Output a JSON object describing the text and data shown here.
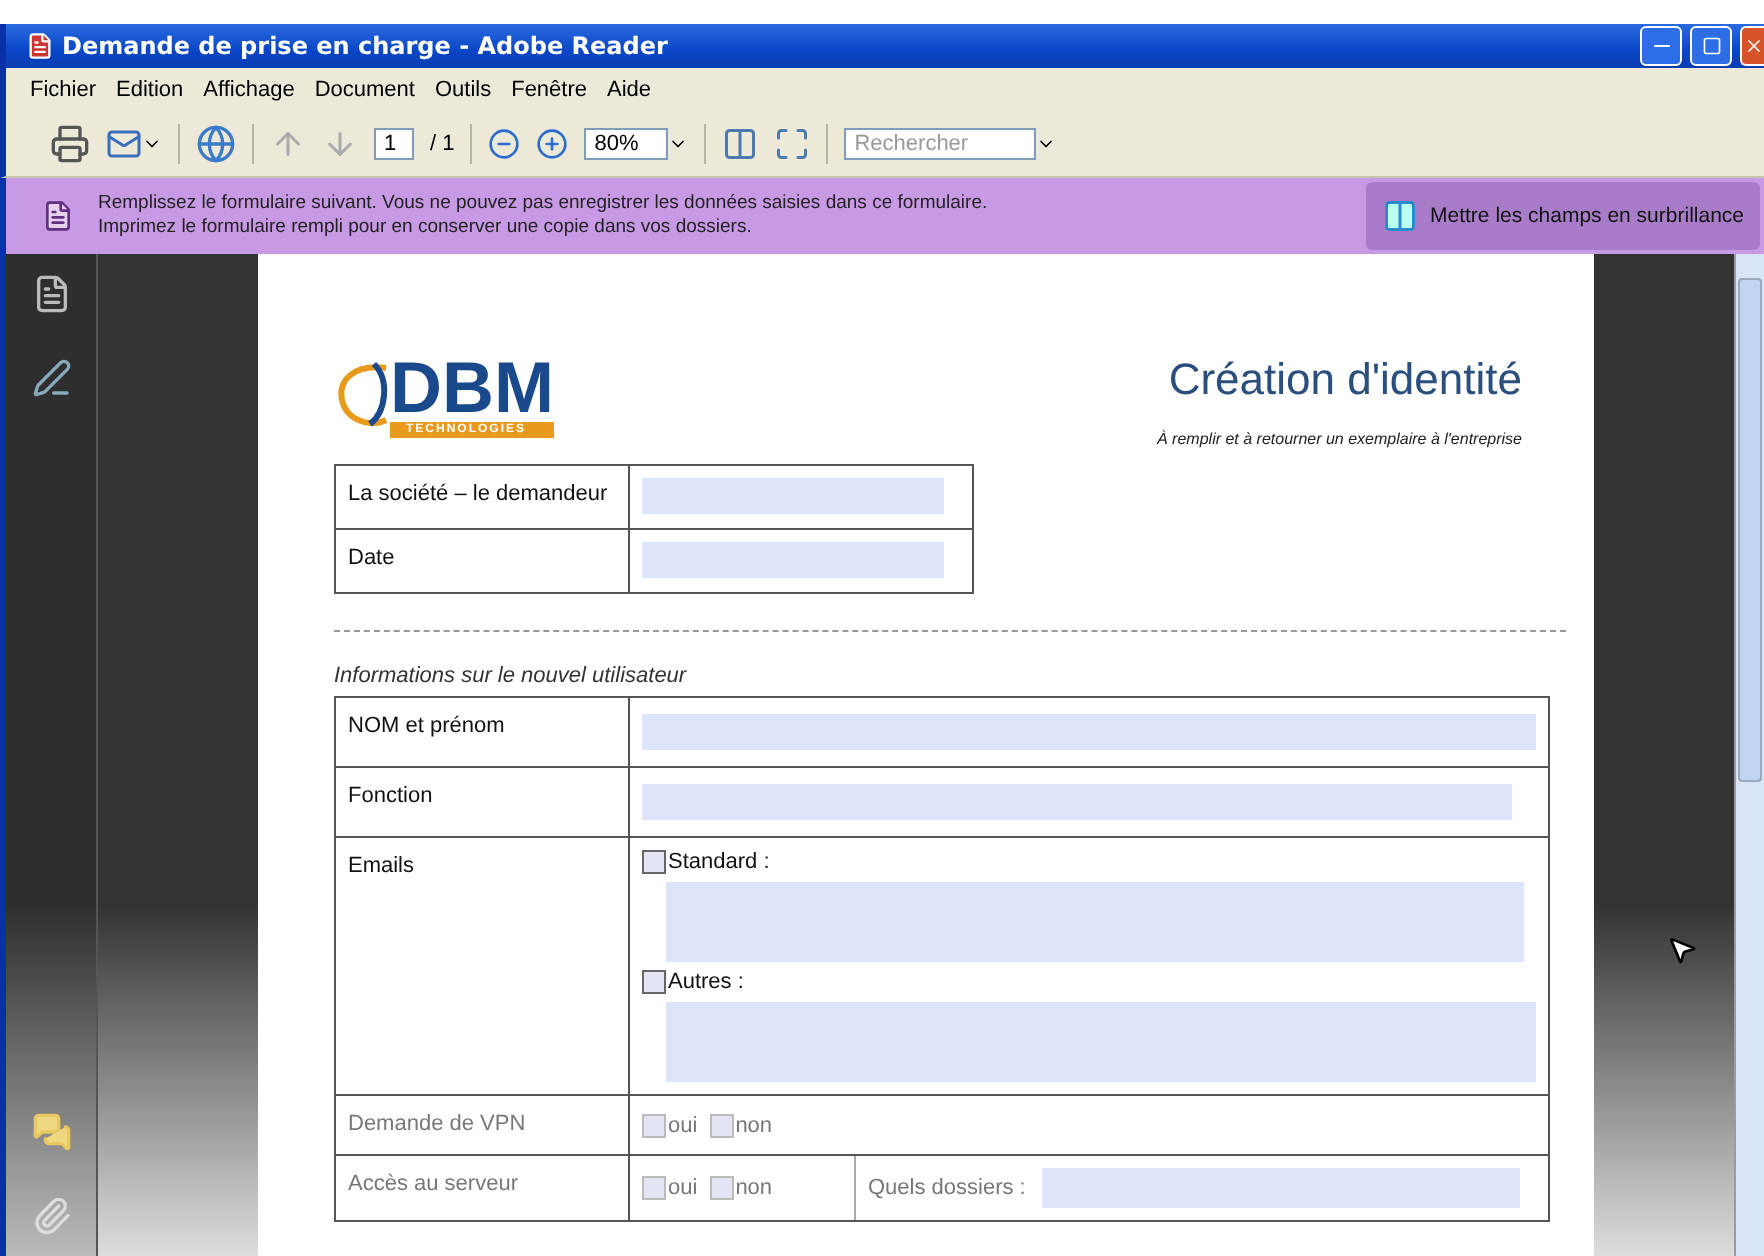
{
  "window": {
    "title": "Demande de prise en charge - Adobe Reader"
  },
  "menu": [
    "Fichier",
    "Edition",
    "Affichage",
    "Document",
    "Outils",
    "Fenêtre",
    "Aide"
  ],
  "toolbar": {
    "page": "1",
    "page_total": "/ 1",
    "zoom": "80%",
    "search": {
      "placeholder": "Rechercher"
    }
  },
  "notice": {
    "lines": [
      "Remplissez le formulaire suivant. Vous ne pouvez pas enregistrer les données saisies dans ce formulaire.",
      "Imprimez le formulaire rempli pour en conserver une copie dans vos dossiers."
    ],
    "button": "Mettre les champs en surbrillance"
  },
  "document": {
    "logo": {
      "name": "DBM",
      "tagline": "TECHNOLOGIES"
    },
    "title": "Création d'identité",
    "subtitle": "À remplir et à retourner un exemplaire à l'entreprise",
    "requester_rows": [
      {
        "label": "La société – le demandeur"
      },
      {
        "label": "Date"
      }
    ],
    "section": "Informations sur le nouvel utilisateur",
    "user_rows": [
      {
        "kind": "text",
        "label": "NOM et prénom"
      },
      {
        "kind": "text",
        "label": "Fonction"
      },
      {
        "kind": "emails",
        "label": "Emails",
        "options": [
          {
            "label": "Standard :",
            "checked": false
          },
          {
            "label": "Autres :",
            "checked": false
          }
        ]
      },
      {
        "kind": "choice",
        "label": "Demande de VPN",
        "options": [
          {
            "label": "oui",
            "checked": false
          },
          {
            "label": "non",
            "checked": false
          }
        ]
      },
      {
        "kind": "choice",
        "label": "Accès au serveur",
        "options": [
          {
            "label": "oui",
            "checked": false
          },
          {
            "label": "non",
            "checked": false
          }
        ],
        "extra": {
          "label": "Quels dossiers :"
        }
      }
    ]
  }
}
